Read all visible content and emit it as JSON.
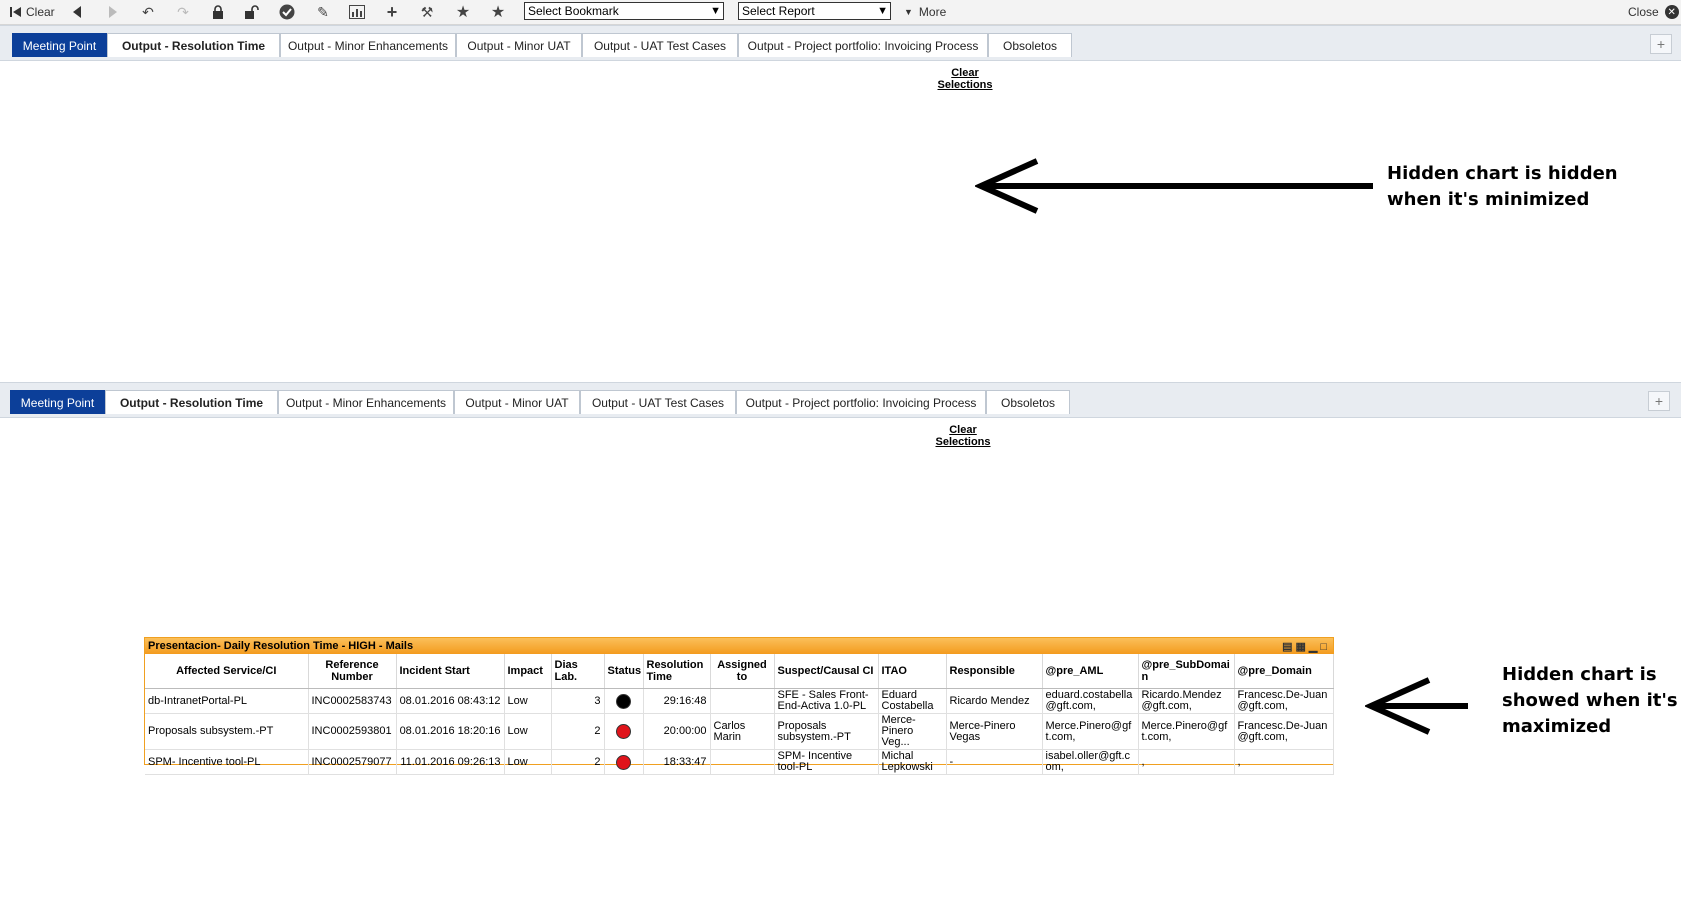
{
  "toolbar": {
    "clear_label": "Clear",
    "bookmark_select": "Select Bookmark",
    "report_select": "Select Report",
    "more_label": "More",
    "close_label": "Close"
  },
  "tabs": [
    {
      "label": "Meeting Point"
    },
    {
      "label": "Output - Resolution Time"
    },
    {
      "label": "Output - Minor Enhancements"
    },
    {
      "label": "Output - Minor UAT"
    },
    {
      "label": "Output - UAT Test Cases"
    },
    {
      "label": "Output - Project portfolio: Invoicing Process"
    },
    {
      "label": "Obsoletos"
    }
  ],
  "clear_selections": {
    "line1": "Clear",
    "line2": "Selections"
  },
  "annotations": {
    "top": {
      "line1": "Hidden chart is hidden",
      "line2": "when it's minimized"
    },
    "bottom": {
      "line1": "Hidden chart is",
      "line2": "showed when it's",
      "line3": "maximized"
    }
  },
  "chart": {
    "title": "Presentacion- Daily Resolution Time - HIGH - Mails",
    "columns": [
      "Affected Service/CI",
      "Reference Number",
      "Incident Start",
      "Impact",
      "Dias Lab.",
      "Status",
      "Resolution Time",
      "Assigned to",
      "Suspect/Causal CI",
      "ITAO",
      "Responsible",
      "@pre_AML",
      "@pre_SubDomain",
      "@pre_Domain"
    ],
    "rows": [
      {
        "service": "db-IntranetPortal-PL",
        "ref": "INC0002583743",
        "start": "08.01.2016 08:43:12",
        "impact": "Low",
        "dias": "3",
        "status_color": "#000000",
        "resolution": "29:16:48",
        "assigned": "",
        "suspect": "SFE - Sales Front-End-Activa 1.0-PL",
        "itao": "Eduard Costabella",
        "responsible": "Ricardo Mendez",
        "aml": "eduard.costabella@gft.com,",
        "subdomain": "Ricardo.Mendez@gft.com,",
        "domain": "Francesc.De-Juan@gft.com,"
      },
      {
        "service": "Proposals subsystem.-PT",
        "ref": "INC0002593801",
        "start": "08.01.2016 18:20:16",
        "impact": "Low",
        "dias": "2",
        "status_color": "#e0141b",
        "resolution": "20:00:00",
        "assigned": "Carlos Marin",
        "suspect": "Proposals subsystem.-PT",
        "itao": "Merce-Pinero Veg...",
        "responsible": "Merce-Pinero Vegas",
        "aml": "Merce.Pinero@gft.com,",
        "subdomain": "Merce.Pinero@gft.com,",
        "domain": "Francesc.De-Juan@gft.com,"
      },
      {
        "service": "SPM- Incentive tool-PL",
        "ref": "INC0002579077",
        "start": "11.01.2016 09:26:13",
        "impact": "Low",
        "dias": "2",
        "status_color": "#e0141b",
        "resolution": "18:33:47",
        "assigned": "",
        "suspect": "SPM- Incentive tool-PL",
        "itao": "Michal Lepkowski",
        "responsible": "-",
        "aml": "isabel.oller@gft.com,",
        "subdomain": ",",
        "domain": ","
      }
    ]
  }
}
